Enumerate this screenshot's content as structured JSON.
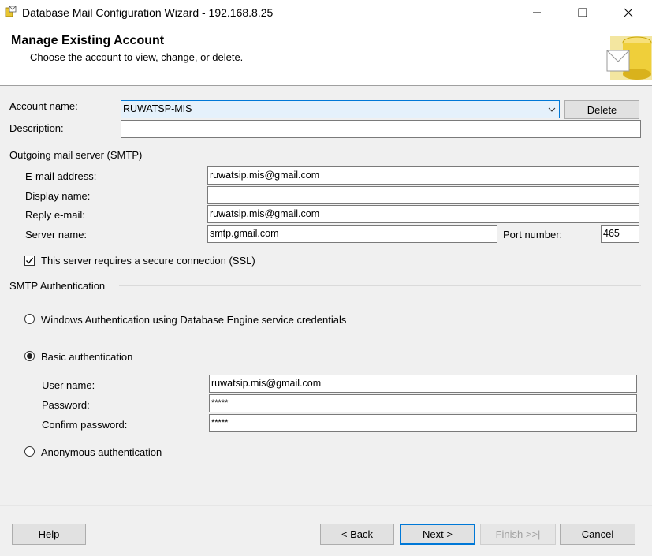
{
  "window": {
    "title": "Database Mail Configuration Wizard - 192.168.8.25",
    "icon": "database-mail-icon"
  },
  "header": {
    "title": "Manage Existing Account",
    "subtitle": "Choose the account to view, change, or delete."
  },
  "account": {
    "name_label": "Account name:",
    "name_value": "RUWATSP-MIS",
    "delete_label": "Delete",
    "description_label": "Description:",
    "description_value": ""
  },
  "smtp": {
    "group_label": "Outgoing mail server (SMTP)",
    "email_label": "E-mail address:",
    "email_value": "ruwatsip.mis@gmail.com",
    "display_label": "Display name:",
    "display_value": "",
    "reply_label": "Reply e-mail:",
    "reply_value": "ruwatsip.mis@gmail.com",
    "server_label": "Server name:",
    "server_value": "smtp.gmail.com",
    "port_label": "Port number:",
    "port_value": "465",
    "ssl_label": "This server requires a secure connection (SSL)",
    "ssl_checked": true
  },
  "auth": {
    "group_label": "SMTP Authentication",
    "windows_label": "Windows Authentication using Database Engine service credentials",
    "basic_label": "Basic authentication",
    "selected": "basic",
    "username_label": "User name:",
    "username_value": "ruwatsip.mis@gmail.com",
    "password_label": "Password:",
    "password_value": "*****",
    "confirm_label": "Confirm password:",
    "confirm_value": "*****",
    "anonymous_label": "Anonymous authentication"
  },
  "footer": {
    "help": "Help",
    "back": "< Back",
    "next": "Next >",
    "finish": "Finish >>|",
    "cancel": "Cancel"
  },
  "colors": {
    "accent": "#0078d7",
    "combo_bg": "#e5f1fb",
    "dialog_bg": "#f0f0f0"
  }
}
